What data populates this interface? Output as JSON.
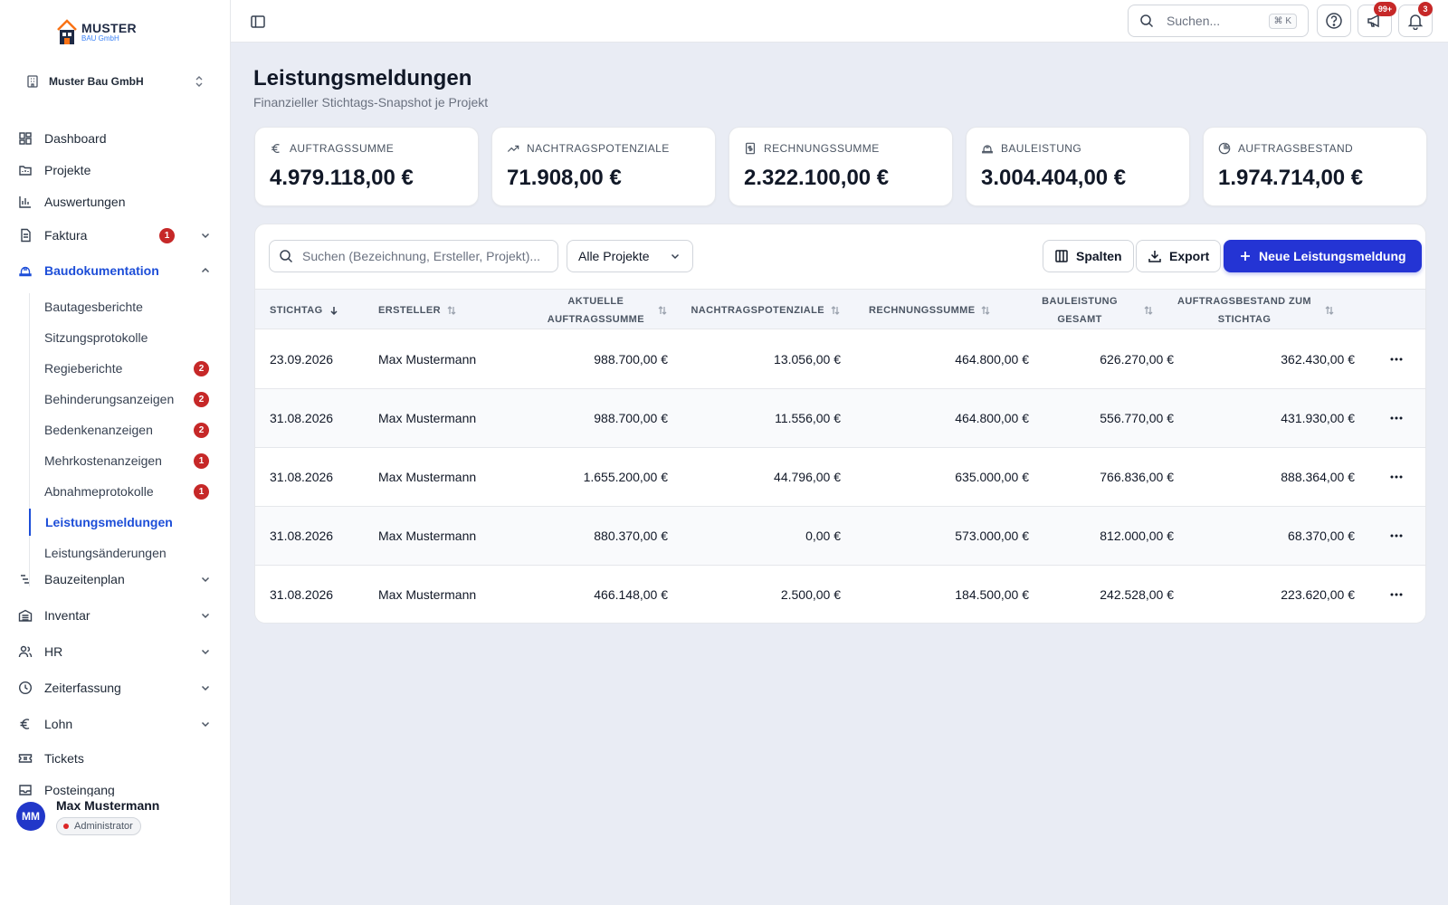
{
  "brand": {
    "name": "MUSTER",
    "sub": "BAU GmbH"
  },
  "company": "Muster Bau GmbH",
  "nav": [
    {
      "label": "Dashboard",
      "icon": "dashboard-icon"
    },
    {
      "label": "Projekte",
      "icon": "folder-icon"
    },
    {
      "label": "Auswertungen",
      "icon": "bar-chart-icon"
    },
    {
      "label": "Faktura",
      "icon": "invoice-icon",
      "badge": "1"
    },
    {
      "label": "Baudokumentation",
      "icon": "hard-hat-icon"
    },
    {
      "label": "Bauzeitenplan",
      "icon": "gantt-icon"
    },
    {
      "label": "Inventar",
      "icon": "inventory-icon"
    },
    {
      "label": "HR",
      "icon": "users-icon"
    },
    {
      "label": "Zeiterfassung",
      "icon": "clock-icon"
    },
    {
      "label": "Lohn",
      "icon": "euro-icon"
    },
    {
      "label": "Tickets",
      "icon": "ticket-icon"
    },
    {
      "label": "Posteingang",
      "icon": "inbox-icon"
    }
  ],
  "subnav": [
    {
      "label": "Bautagesberichte"
    },
    {
      "label": "Sitzungsprotokolle"
    },
    {
      "label": "Regieberichte",
      "badge": "2"
    },
    {
      "label": "Behinderungsanzeigen",
      "badge": "2"
    },
    {
      "label": "Bedenkenanzeigen",
      "badge": "2"
    },
    {
      "label": "Mehrkostenanzeigen",
      "badge": "1"
    },
    {
      "label": "Abnahmeprotokolle",
      "badge": "1"
    },
    {
      "label": "Leistungsmeldungen"
    },
    {
      "label": "Leistungsänderungen"
    }
  ],
  "user": {
    "initials": "MM",
    "name": "Max Mustermann",
    "role": "Administrator"
  },
  "topbar": {
    "search_placeholder": "Suchen...",
    "shortcut": "⌘ K",
    "announce_badge": "99+",
    "notif_badge": "3"
  },
  "page": {
    "title": "Leistungsmeldungen",
    "subtitle": "Finanzieller Stichtags-Snapshot je Projekt"
  },
  "kpis": [
    {
      "label": "AUFTRAGSSUMME",
      "value": "4.979.118,00 €",
      "icon": "euro-icon"
    },
    {
      "label": "NACHTRAGSPOTENZIALE",
      "value": "71.908,00 €",
      "icon": "trending-up-icon"
    },
    {
      "label": "RECHNUNGSSUMME",
      "value": "2.322.100,00 €",
      "icon": "receipt-icon"
    },
    {
      "label": "BAULEISTUNG",
      "value": "3.004.404,00 €",
      "icon": "hard-hat-icon"
    },
    {
      "label": "AUFTRAGSBESTAND",
      "value": "1.974.714,00 €",
      "icon": "pie-chart-icon"
    }
  ],
  "toolbar": {
    "search_placeholder": "Suchen (Bezeichnung, Ersteller, Projekt)...",
    "filter_value": "Alle Projekte",
    "columns_label": "Spalten",
    "export_label": "Export",
    "new_label": "Neue Leistungsmeldung"
  },
  "table": {
    "headers": {
      "stichtag": "STICHTAG",
      "ersteller": "ERSTELLER",
      "auftragssumme_1": "AKTUELLE",
      "auftragssumme_2": "AUFTRAGSSUMME",
      "nachtrag": "NACHTRAGSPOTENZIALE",
      "rechnung": "RECHNUNGSSUMME",
      "bauleistung_1": "BAULEISTUNG",
      "bauleistung_2": "GESAMT",
      "bestand_1": "AUFTRAGSBESTAND ZUM",
      "bestand_2": "STICHTAG"
    },
    "rows": [
      {
        "stichtag": "23.09.2026",
        "ersteller": "Max Mustermann",
        "auftragssumme": "988.700,00 €",
        "nachtrag": "13.056,00 €",
        "rechnung": "464.800,00 €",
        "bauleistung": "626.270,00 €",
        "bestand": "362.430,00 €"
      },
      {
        "stichtag": "31.08.2026",
        "ersteller": "Max Mustermann",
        "auftragssumme": "988.700,00 €",
        "nachtrag": "11.556,00 €",
        "rechnung": "464.800,00 €",
        "bauleistung": "556.770,00 €",
        "bestand": "431.930,00 €"
      },
      {
        "stichtag": "31.08.2026",
        "ersteller": "Max Mustermann",
        "auftragssumme": "1.655.200,00 €",
        "nachtrag": "44.796,00 €",
        "rechnung": "635.000,00 €",
        "bauleistung": "766.836,00 €",
        "bestand": "888.364,00 €"
      },
      {
        "stichtag": "31.08.2026",
        "ersteller": "Max Mustermann",
        "auftragssumme": "880.370,00 €",
        "nachtrag": "0,00 €",
        "rechnung": "573.000,00 €",
        "bauleistung": "812.000,00 €",
        "bestand": "68.370,00 €"
      },
      {
        "stichtag": "31.08.2026",
        "ersteller": "Max Mustermann",
        "auftragssumme": "466.148,00 €",
        "nachtrag": "2.500,00 €",
        "rechnung": "184.500,00 €",
        "bauleistung": "242.528,00 €",
        "bestand": "223.620,00 €"
      }
    ]
  },
  "colors": {
    "accent": "#2434d4",
    "active": "#1d4ed8",
    "badge": "#c62828"
  }
}
